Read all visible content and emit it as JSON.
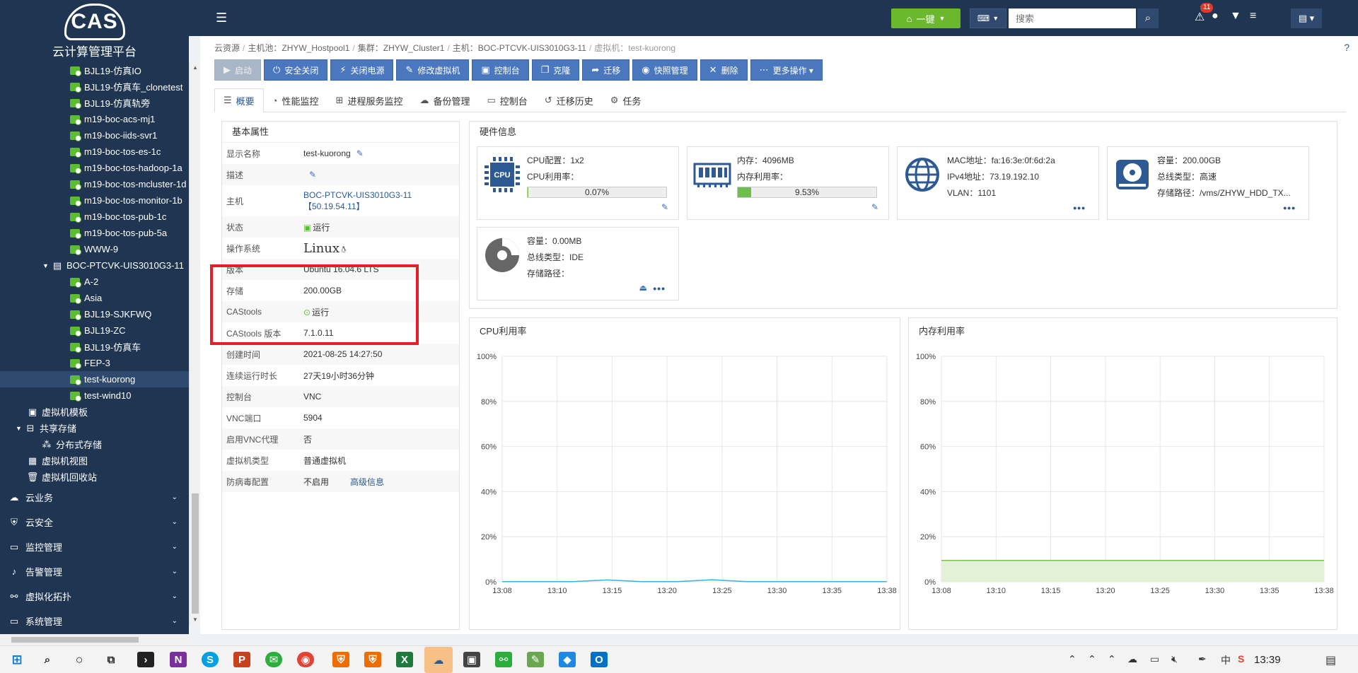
{
  "app": {
    "logo_text": "CAS",
    "logo_subtitle": "云计算管理平台"
  },
  "sidebar": {
    "vms_top": [
      "BJL19-仿真IO",
      "BJL19-仿真车_clonetest",
      "BJL19-仿真轨旁",
      "m19-boc-acs-mj1",
      "m19-boc-iids-svr1",
      "m19-boc-tos-es-1c",
      "m19-boc-tos-hadoop-1a",
      "m19-boc-tos-mcluster-1d",
      "m19-boc-tos-monitor-1b",
      "m19-boc-tos-pub-1c",
      "m19-boc-tos-pub-5a",
      "WWW-9"
    ],
    "host": "BOC-PTCVK-UIS3010G3-11",
    "vms_host": [
      "A-2",
      "Asia",
      "BJL19-SJKFWQ",
      "BJL19-ZC",
      "BJL19-仿真车",
      "FEP-3",
      "test-kuorong",
      "test-wind10"
    ],
    "selected_vm": "test-kuorong",
    "extra": [
      "虚拟机模板",
      "共享存储",
      "分布式存储",
      "虚拟机视图",
      "虚拟机回收站"
    ],
    "menus": [
      "云业务",
      "云安全",
      "监控管理",
      "告警管理",
      "虚拟化拓扑",
      "系统管理"
    ]
  },
  "topbar": {
    "onekey_label": "一键",
    "lang_label": "⌨",
    "search_placeholder": "搜索",
    "alert_count": "11"
  },
  "breadcrumb": [
    {
      "label": "云资源"
    },
    {
      "label": "主机池：ZHYW_Hostpool1"
    },
    {
      "label": "集群：ZHYW_Cluster1"
    },
    {
      "label": "主机：BOC-PTCVK-UIS3010G3-11"
    },
    {
      "label": "虚拟机：test-kuorong"
    }
  ],
  "toolbar": [
    {
      "label": "启动",
      "icon": "play-icon",
      "glyph": "▶",
      "disabled": true
    },
    {
      "label": "安全关闭",
      "icon": "power-icon",
      "glyph": "⏻",
      "disabled": false
    },
    {
      "label": "关闭电源",
      "icon": "plug-icon",
      "glyph": "⚡",
      "disabled": false
    },
    {
      "label": "修改虚拟机",
      "icon": "edit-icon",
      "glyph": "✎",
      "disabled": false
    },
    {
      "label": "控制台",
      "icon": "console-icon",
      "glyph": "▣",
      "disabled": false
    },
    {
      "label": "克隆",
      "icon": "clone-icon",
      "glyph": "❐",
      "disabled": false
    },
    {
      "label": "迁移",
      "icon": "migrate-icon",
      "glyph": "➦",
      "disabled": false
    },
    {
      "label": "快照管理",
      "icon": "camera-icon",
      "glyph": "◉",
      "disabled": false
    },
    {
      "label": "删除",
      "icon": "delete-icon",
      "glyph": "✕",
      "disabled": false
    },
    {
      "label": "更多操作 ▾",
      "icon": "more-icon",
      "glyph": "⋯",
      "disabled": false
    }
  ],
  "tabs": [
    {
      "label": "概要",
      "icon": "list-icon",
      "glyph": "☰",
      "active": true
    },
    {
      "label": "性能监控",
      "icon": "gauge-icon",
      "glyph": "◔",
      "active": false
    },
    {
      "label": "进程服务监控",
      "icon": "monitor-icon",
      "glyph": "⊞",
      "active": false
    },
    {
      "label": "备份管理",
      "icon": "cloud-icon",
      "glyph": "☁",
      "active": false
    },
    {
      "label": "控制台",
      "icon": "console-icon",
      "glyph": "▭",
      "active": false
    },
    {
      "label": "迁移历史",
      "icon": "history-icon",
      "glyph": "↺",
      "active": false
    },
    {
      "label": "任务",
      "icon": "gear-icon",
      "glyph": "⚙",
      "active": false
    }
  ],
  "props": {
    "title": "基本属性",
    "rows": [
      {
        "k": "显示名称",
        "v": "test-kuorong"
      },
      {
        "k": "描述",
        "v": ""
      },
      {
        "k": "主机",
        "v": "BOC-PTCVK-UIS3010G3-11 【50.19.54.11】"
      },
      {
        "k": "状态",
        "v": "运行"
      },
      {
        "k": "操作系统",
        "v": "Linux"
      },
      {
        "k": "版本",
        "v": "Ubuntu 16.04.6 LTS"
      },
      {
        "k": "存储",
        "v": "200.00GB"
      },
      {
        "k": "CAStools",
        "v": "运行"
      },
      {
        "k": "CAStools 版本",
        "v": "7.1.0.11"
      },
      {
        "k": "创建时间",
        "v": "2021-08-25 14:27:50"
      },
      {
        "k": "连续运行时长",
        "v": "27天19小时36分钟"
      },
      {
        "k": "控制台",
        "v": "VNC"
      },
      {
        "k": "VNC端口",
        "v": "5904"
      },
      {
        "k": "启用VNC代理",
        "v": "否"
      },
      {
        "k": "虚拟机类型",
        "v": "普通虚拟机"
      },
      {
        "k": "防病毒配置",
        "v": "不启用"
      }
    ],
    "advanced_link": "高级信息"
  },
  "hardware": {
    "title": "硬件信息",
    "cpu": {
      "icon_text": "CPU",
      "l1": "CPU配置：1x2",
      "l2": "CPU利用率：",
      "util": "0.07%",
      "util_frac": 0.0007
    },
    "mem": {
      "l1": "内存：4096MB",
      "l2": "内存利用率：",
      "util": "9.53%",
      "util_frac": 0.0953
    },
    "net": {
      "l1": "MAC地址：fa:16:3e:0f:6d:2a",
      "l2": "IPv4地址：73.19.192.10",
      "l3": "VLAN：1101"
    },
    "disk": {
      "l1": "容量：200.00GB",
      "l2": "总线类型：高速",
      "l3": "存储路径：/vms/ZHYW_HDD_TX..."
    },
    "cd": {
      "l1": "容量：0.00MB",
      "l2": "总线类型：IDE",
      "l3": "存储路径："
    }
  },
  "chart_data": [
    {
      "type": "line",
      "title": "CPU利用率",
      "x": [
        "13:08",
        "13:10",
        "13:15",
        "13:20",
        "13:25",
        "13:30",
        "13:35",
        "13:38"
      ],
      "yticks": [
        "100%",
        "80%",
        "60%",
        "40%",
        "20%",
        "0%"
      ],
      "ylim": [
        0,
        100
      ],
      "series": [
        {
          "values": [
            0.1,
            0.1,
            0.1,
            0.8,
            0.1,
            0.1,
            0.9,
            0.1,
            0.1,
            0.1,
            0.1,
            0.1
          ]
        }
      ],
      "color": "#3ab0e2",
      "fill": false
    },
    {
      "type": "area",
      "title": "内存利用率",
      "x": [
        "13:08",
        "13:10",
        "13:15",
        "13:20",
        "13:25",
        "13:30",
        "13:35",
        "13:38"
      ],
      "yticks": [
        "100%",
        "80%",
        "60%",
        "40%",
        "20%",
        "0%"
      ],
      "ylim": [
        0,
        100
      ],
      "series": [
        {
          "values": [
            9.5,
            9.5,
            9.5,
            9.5,
            9.5,
            9.5,
            9.5,
            9.5,
            9.5,
            9.5,
            9.5,
            9.5
          ]
        }
      ],
      "color": "#7cc34a",
      "fill": true
    }
  ],
  "taskbar": {
    "time": "13:39"
  }
}
